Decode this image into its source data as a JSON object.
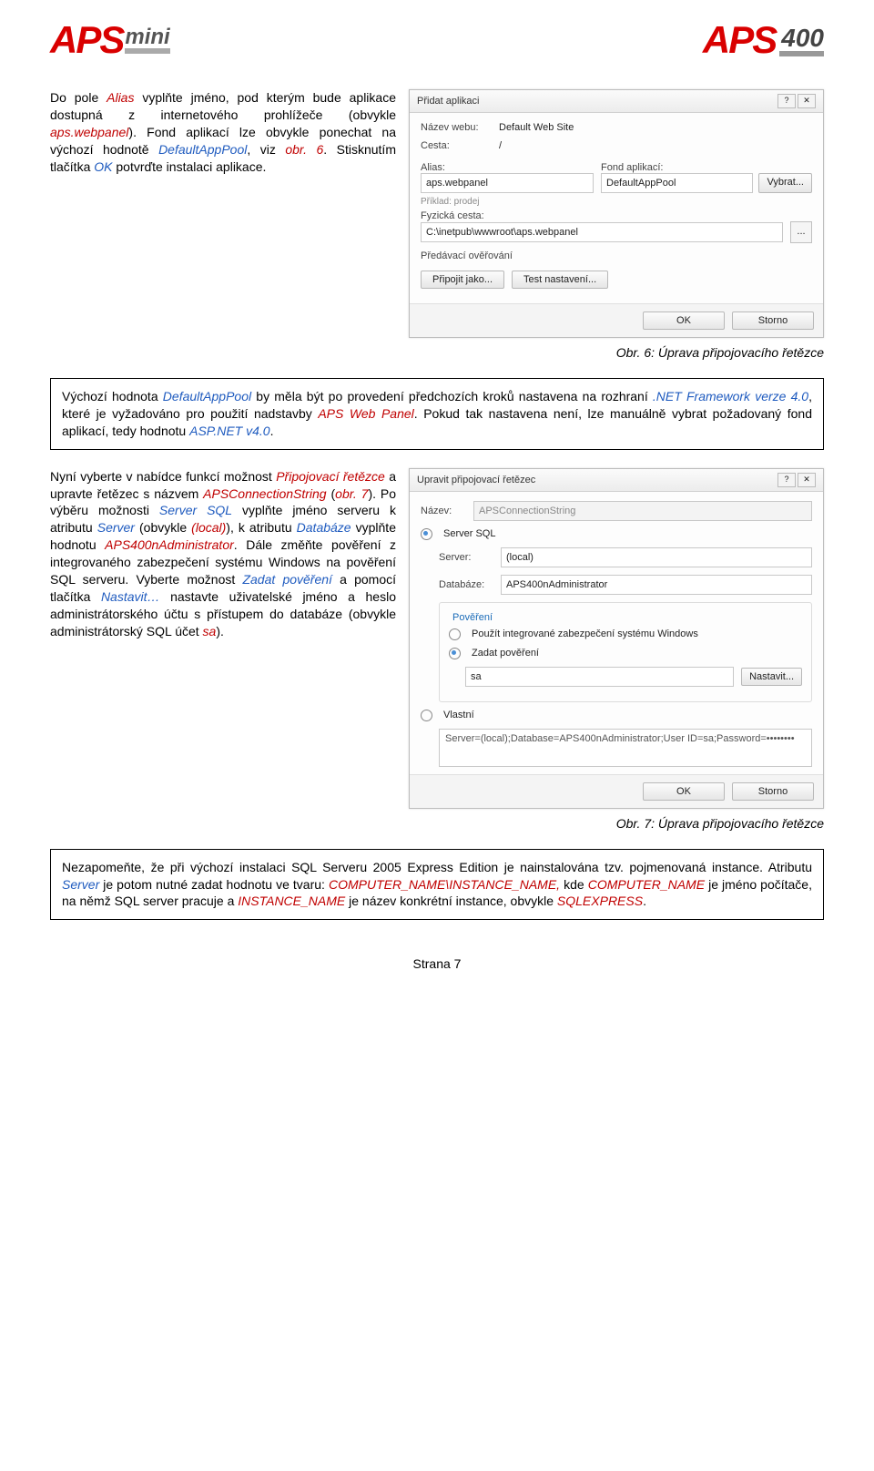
{
  "logos": {
    "left_brand": "APS",
    "left_suffix": "mini",
    "right_brand": "APS",
    "right_suffix": "400"
  },
  "para1": {
    "t1": "Do pole ",
    "alias": "Alias",
    "t2": " vyplňte jméno, pod kterým bude aplikace dostupná z internetového prohlížeče (obvykle ",
    "apsweb": "aps.webpanel",
    "t3": "). Fond aplikací lze obvykle ponechat na výchozí hodnotě ",
    "dap": "DefaultAppPool",
    "t4": ", viz ",
    "obr6ref": "obr. 6",
    "t5": ". Stisknutím tlačítka ",
    "ok": "OK",
    "t6": " potvrďte instalaci aplikace."
  },
  "dlg1": {
    "title": "Přidat aplikaci",
    "lbl_webname": "Název webu:",
    "val_webname": "Default Web Site",
    "lbl_path": "Cesta:",
    "val_path": "/",
    "lbl_alias": "Alias:",
    "val_alias": "aps.webpanel",
    "lbl_apppool": "Fond aplikací:",
    "val_apppool": "DefaultAppPool",
    "btn_select": "Vybrat...",
    "lbl_example": "Příklad: prodej",
    "lbl_physpath": "Fyzická cesta:",
    "val_physpath": "C:\\inetpub\\wwwroot\\aps.webpanel",
    "btn_browse": "...",
    "lbl_passauth": "Předávací ověřování",
    "btn_connectas": "Připojit jako...",
    "btn_test": "Test nastavení...",
    "btn_ok": "OK",
    "btn_cancel": "Storno"
  },
  "cap1": "Obr. 6: Úprava připojovacího řetězce",
  "note1": {
    "t1": "Výchozí hodnota ",
    "dap": "DefaultAppPool",
    "t2": " by měla být po provedení předchozích kroků nastavena na rozhraní ",
    "net": ".NET Framework verze 4.0",
    "t3": ", které je vyžadováno pro použití nadstavby ",
    "apswp": "APS Web Panel",
    "t4": ". Pokud tak nastavena není, lze manuálně vybrat požadovaný fond aplikací, tedy hodnotu ",
    "aspnet": "ASP.NET v4.0",
    "t5": "."
  },
  "para2": {
    "t1": "Nyní vyberte v nabídce funkcí možnost ",
    "connstr_menu": "Připojovací řetězce",
    "t2": " a upravte řetězec s názvem ",
    "apsconn": "APSConnectionString",
    "t3": " (",
    "obr7ref": "obr. 7",
    "t3b": "). Po výběru možnosti ",
    "serversql": "Server SQL",
    "t4": " vyplňte jméno serveru k atributu ",
    "server": "Server",
    "t5": " (obvykle ",
    "local": "(local)",
    "t6": "), k atributu ",
    "database": "Databáze",
    "t7": " vyplňte hodnotu ",
    "apsadmin": "APS400nAdministrator",
    "t8": ". Dále změňte pověření z integrovaného zabezpečení systému Windows na pověření SQL serveru. Vyberte možnost ",
    "zadat": "Zadat pověření",
    "t9": " a pomocí tlačítka ",
    "nastavit": "Nastavit…",
    "t10": " nastavte uživatelské jméno a heslo administrátorského účtu s přístupem do databáze (obvykle administrátorský SQL účet ",
    "sa": "sa",
    "t11": ")."
  },
  "dlg2": {
    "title": "Upravit připojovací řetězec",
    "lbl_name": "Název:",
    "val_name": "APSConnectionString",
    "opt_serversql": "Server SQL",
    "lbl_server": "Server:",
    "val_server": "(local)",
    "lbl_database": "Databáze:",
    "val_database": "APS400nAdministrator",
    "grp_cred": "Pověření",
    "opt_winauth": "Použít integrované zabezpečení systému Windows",
    "opt_setcred": "Zadat pověření",
    "val_user": "sa",
    "btn_set": "Nastavit...",
    "opt_custom": "Vlastní",
    "val_conn": "Server=(local);Database=APS400nAdministrator;User ID=sa;Password=••••••••",
    "btn_ok": "OK",
    "btn_cancel": "Storno"
  },
  "cap2": "Obr. 7: Úprava připojovacího řetězce",
  "note2": {
    "t1": "Nezapomeňte, že při výchozí instalaci SQL Serveru 2005 Express Edition je nainstalována tzv. pojmenovaná instance. Atributu ",
    "server": "Server",
    "t2": " je potom nutné zadat hodnotu ve tvaru: ",
    "fmt": "COMPUTER_NAME\\INSTANCE_NAME,",
    "t3": " kde ",
    "cn": "COMPUTER_NAME",
    "t4": " je jméno počítače, na němž SQL server pracuje a ",
    "in": "INSTANCE_NAME",
    "t5": " je název konkrétní instance, obvykle ",
    "sq": "SQLEXPRESS",
    "t6": "."
  },
  "footer": "Strana 7"
}
